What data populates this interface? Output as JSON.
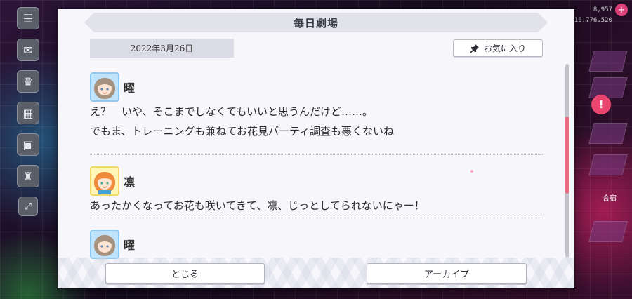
{
  "background": {
    "counters": [
      "8,957",
      "16,776,520"
    ],
    "right_label": "合宿",
    "bubble": "!"
  },
  "dialog": {
    "title": "毎日劇場",
    "date": "2022年3月26日",
    "favorite_label": "お気に入り",
    "entries": [
      {
        "speaker": "曜",
        "lines": [
          "え？　いや、そこまでしなくてもいいと思うんだけど……。",
          "でもま、トレーニングも兼ねてお花見パーティ調査も悪くないね"
        ]
      },
      {
        "speaker": "凛",
        "lines": [
          "あったかくなってお花も咲いてきて、凛、じっとしてられないにゃー！"
        ]
      },
      {
        "speaker": "曜",
        "lines": []
      }
    ],
    "scroll_position": 0.45,
    "close_label": "とじる",
    "archive_label": "アーカイブ"
  },
  "colors": {
    "scroll_thumb": "#e86b7e",
    "panel": "#f7f7fb",
    "title_banner": "#e2e2ea"
  },
  "icons": [
    "menu-icon",
    "chat-icon",
    "present-icon",
    "gift-icon",
    "image-icon",
    "trophy-icon",
    "expand-icon",
    "pin-icon"
  ]
}
